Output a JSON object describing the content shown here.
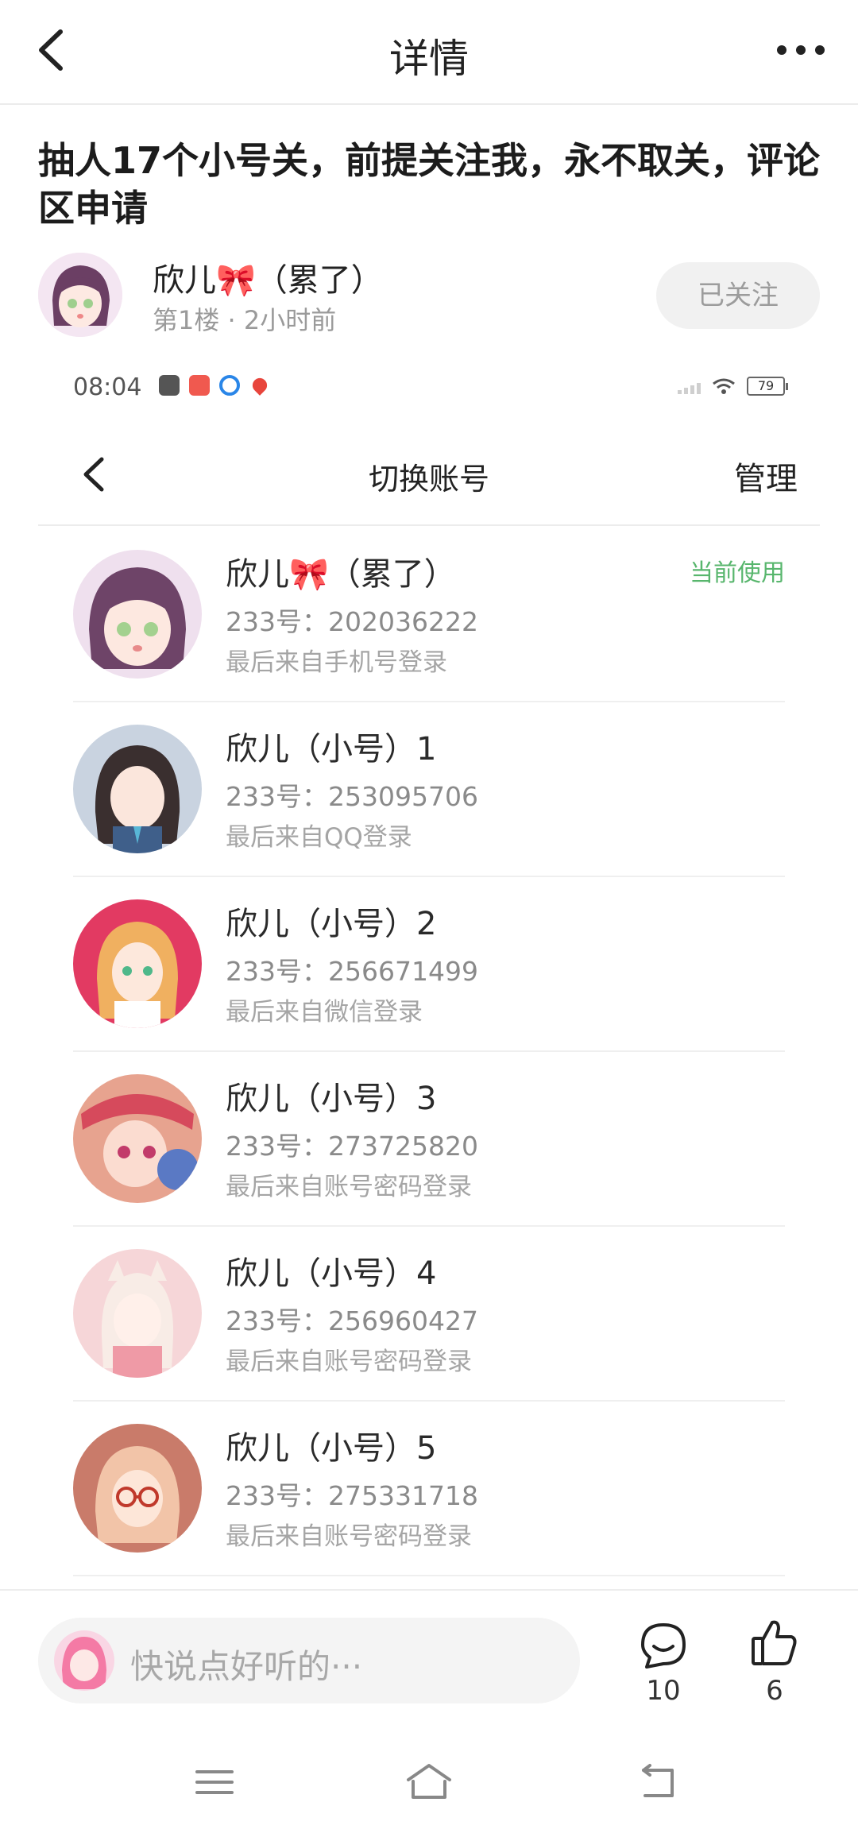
{
  "header": {
    "title": "详情"
  },
  "post": {
    "title": "抽人17个小号关，前提关注我，永不取关，评论区申请",
    "author_name": "欣儿🎀（累了）",
    "meta": "第1楼 · 2小时前",
    "follow_label": "已关注"
  },
  "screenshot": {
    "status_time": "08:04",
    "battery": "79",
    "title": "切换账号",
    "manage_label": "管理",
    "accounts": [
      {
        "name": "欣儿🎀（累了）",
        "number": "233号：202036222",
        "source": "最后来自手机号登录",
        "badge": "当前使用",
        "avatar_color": "#e8c9e6"
      },
      {
        "name": "欣儿（小号）1",
        "number": "233号：253095706",
        "source": "最后来自QQ登录",
        "badge": "",
        "avatar_color": "#b9c6d8"
      },
      {
        "name": "欣儿（小号）2",
        "number": "233号：256671499",
        "source": "最后来自微信登录",
        "badge": "",
        "avatar_color": "#e23a62"
      },
      {
        "name": "欣儿（小号）3",
        "number": "233号：273725820",
        "source": "最后来自账号密码登录",
        "badge": "",
        "avatar_color": "#d9827a"
      },
      {
        "name": "欣儿（小号）4",
        "number": "233号：256960427",
        "source": "最后来自账号密码登录",
        "badge": "",
        "avatar_color": "#f3c7cc"
      },
      {
        "name": "欣儿（小号）5",
        "number": "233号：275331718",
        "source": "最后来自账号密码登录",
        "badge": "",
        "avatar_color": "#e8b5a2"
      }
    ]
  },
  "comment_bar": {
    "placeholder": "快说点好听的···",
    "comment_count": "10",
    "like_count": "6"
  },
  "icons": {
    "back": "chevron-left-icon",
    "more": "more-dots-icon",
    "comment": "comment-bubble-icon",
    "like": "thumbs-up-icon",
    "nav_menu": "menu-icon",
    "nav_home": "home-icon",
    "nav_back": "return-icon"
  }
}
